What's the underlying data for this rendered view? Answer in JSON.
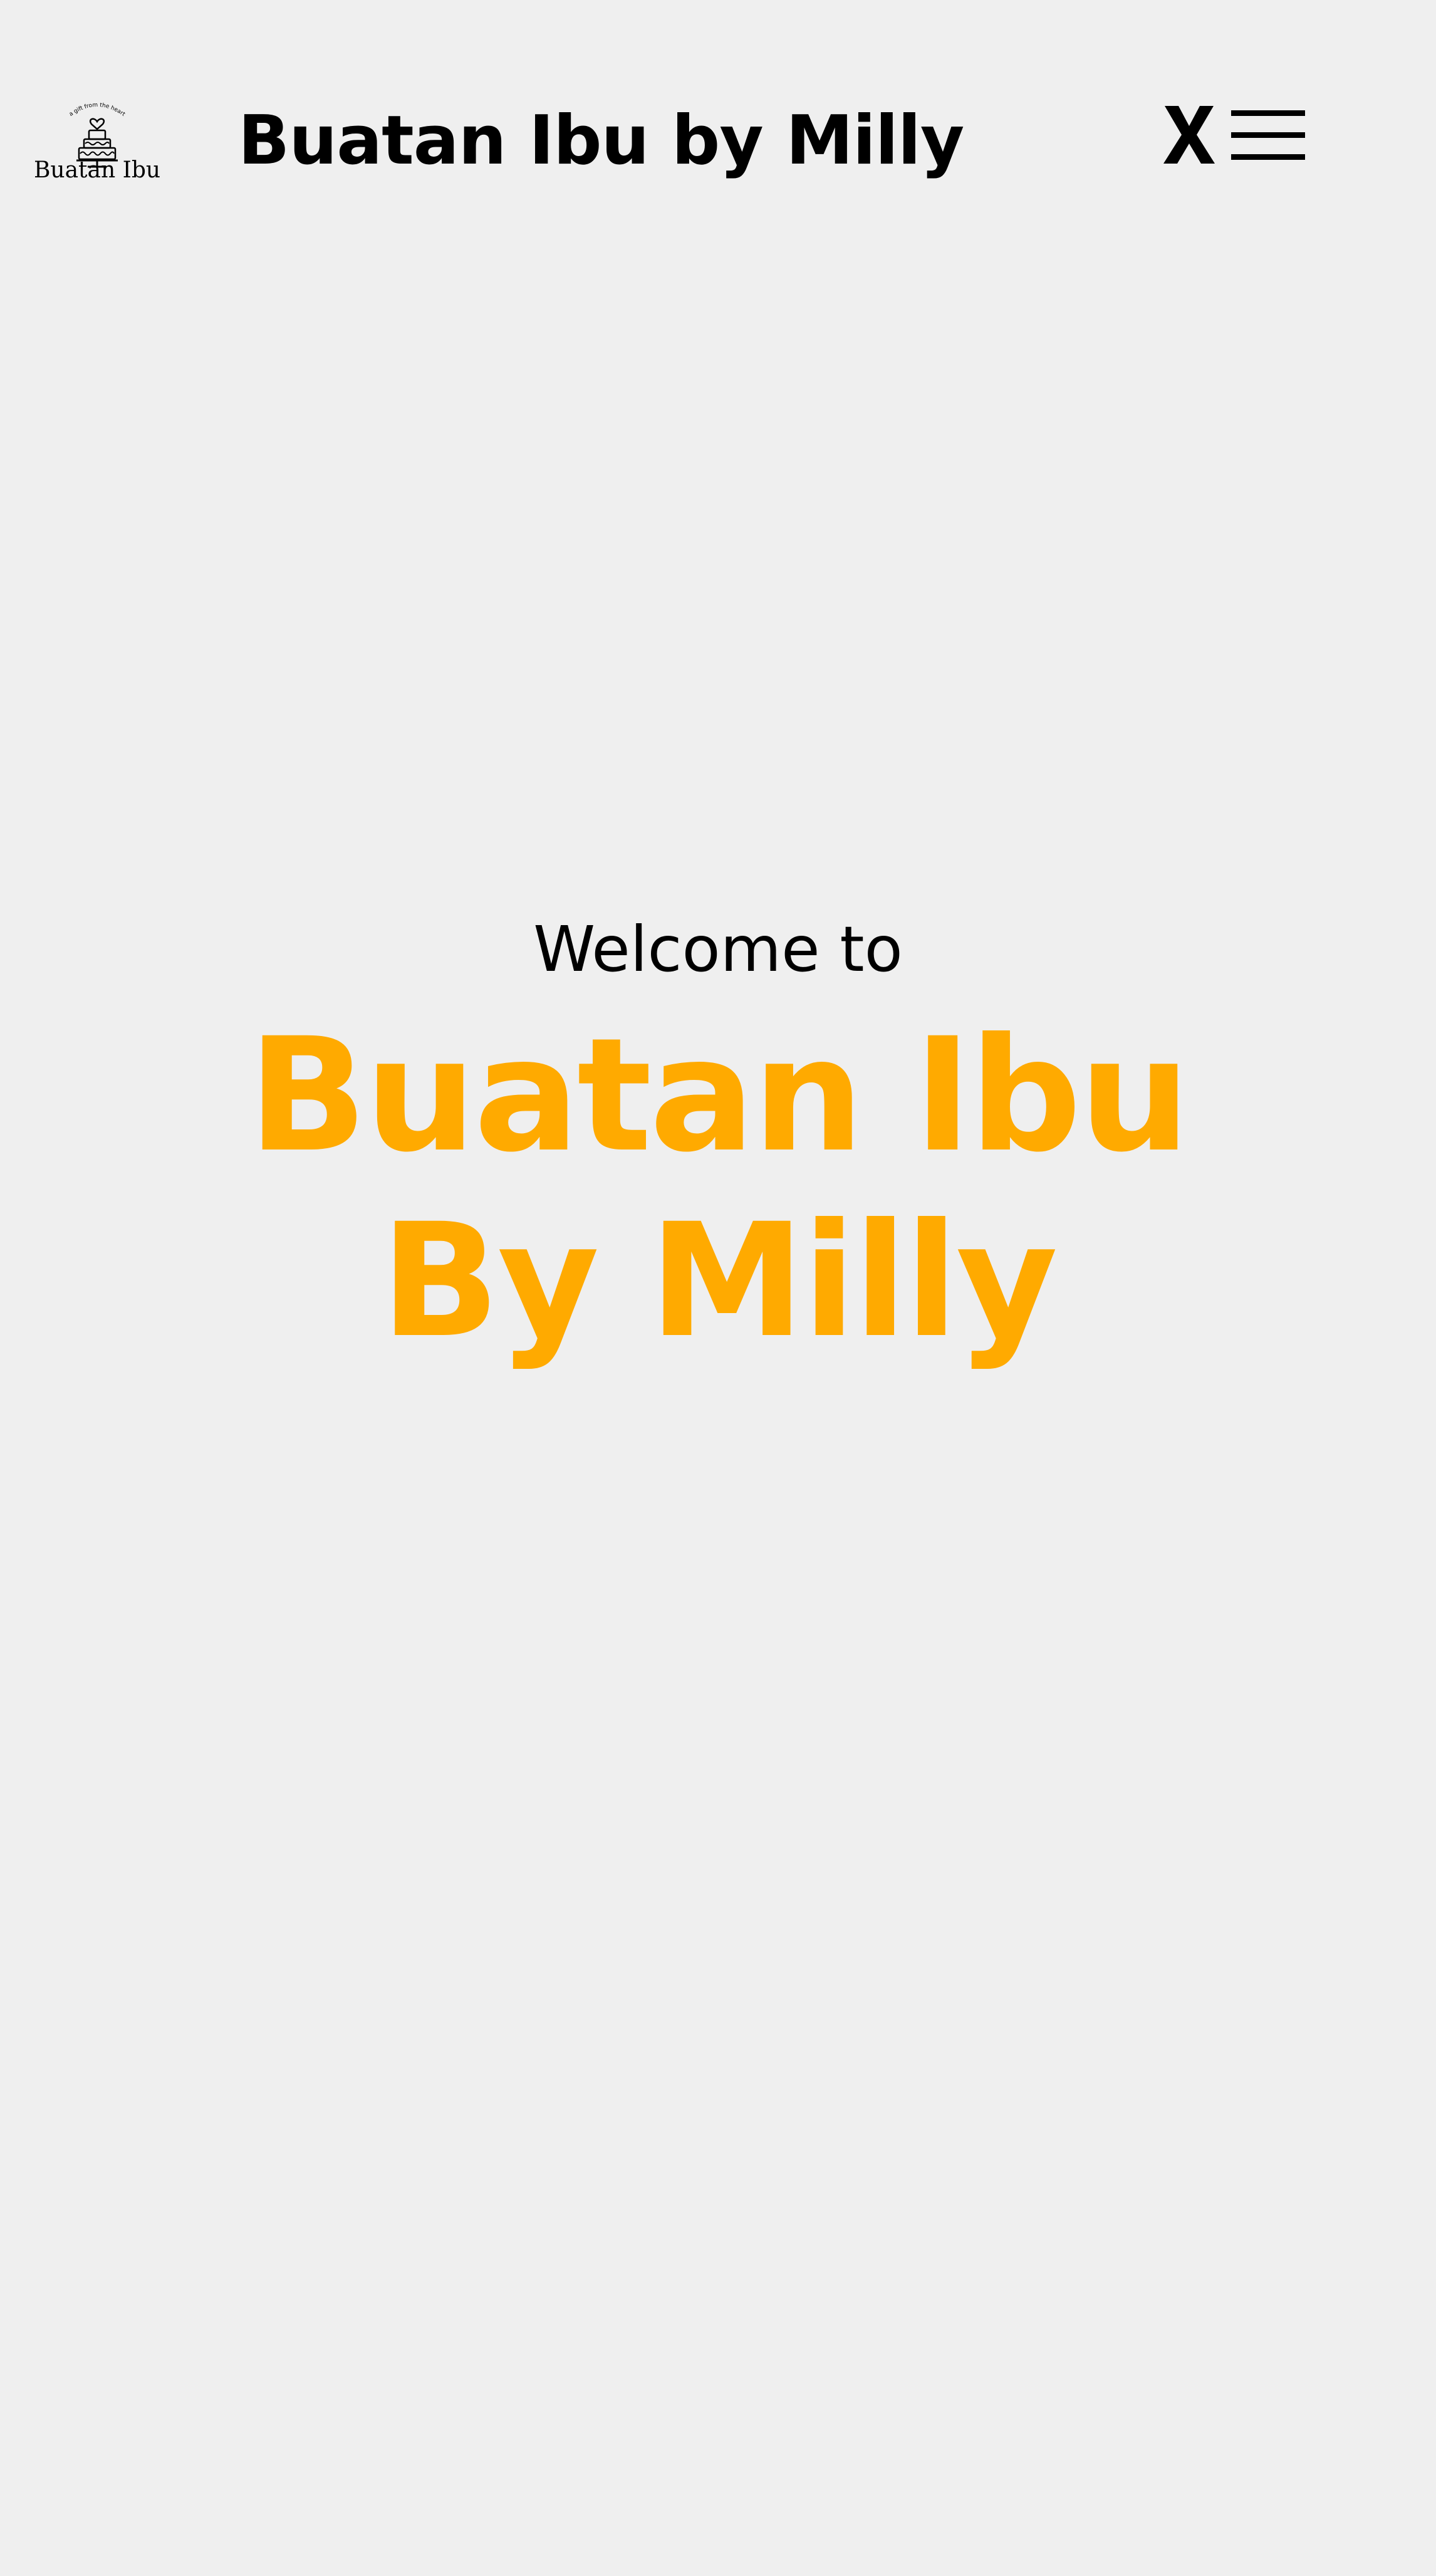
{
  "header": {
    "logo": {
      "tagline": "a gift from the heart",
      "wordmark": "Buatan Ibu"
    },
    "title": "Buatan Ibu by Milly",
    "close_icon": "close-icon",
    "menu_icon": "hamburger-menu-icon"
  },
  "hero": {
    "welcome": "Welcome to",
    "name_line1": "Buatan Ibu",
    "name_line2": "By Milly"
  },
  "colors": {
    "background": "#efefef",
    "accent": "#ffaa00",
    "text": "#000000"
  }
}
